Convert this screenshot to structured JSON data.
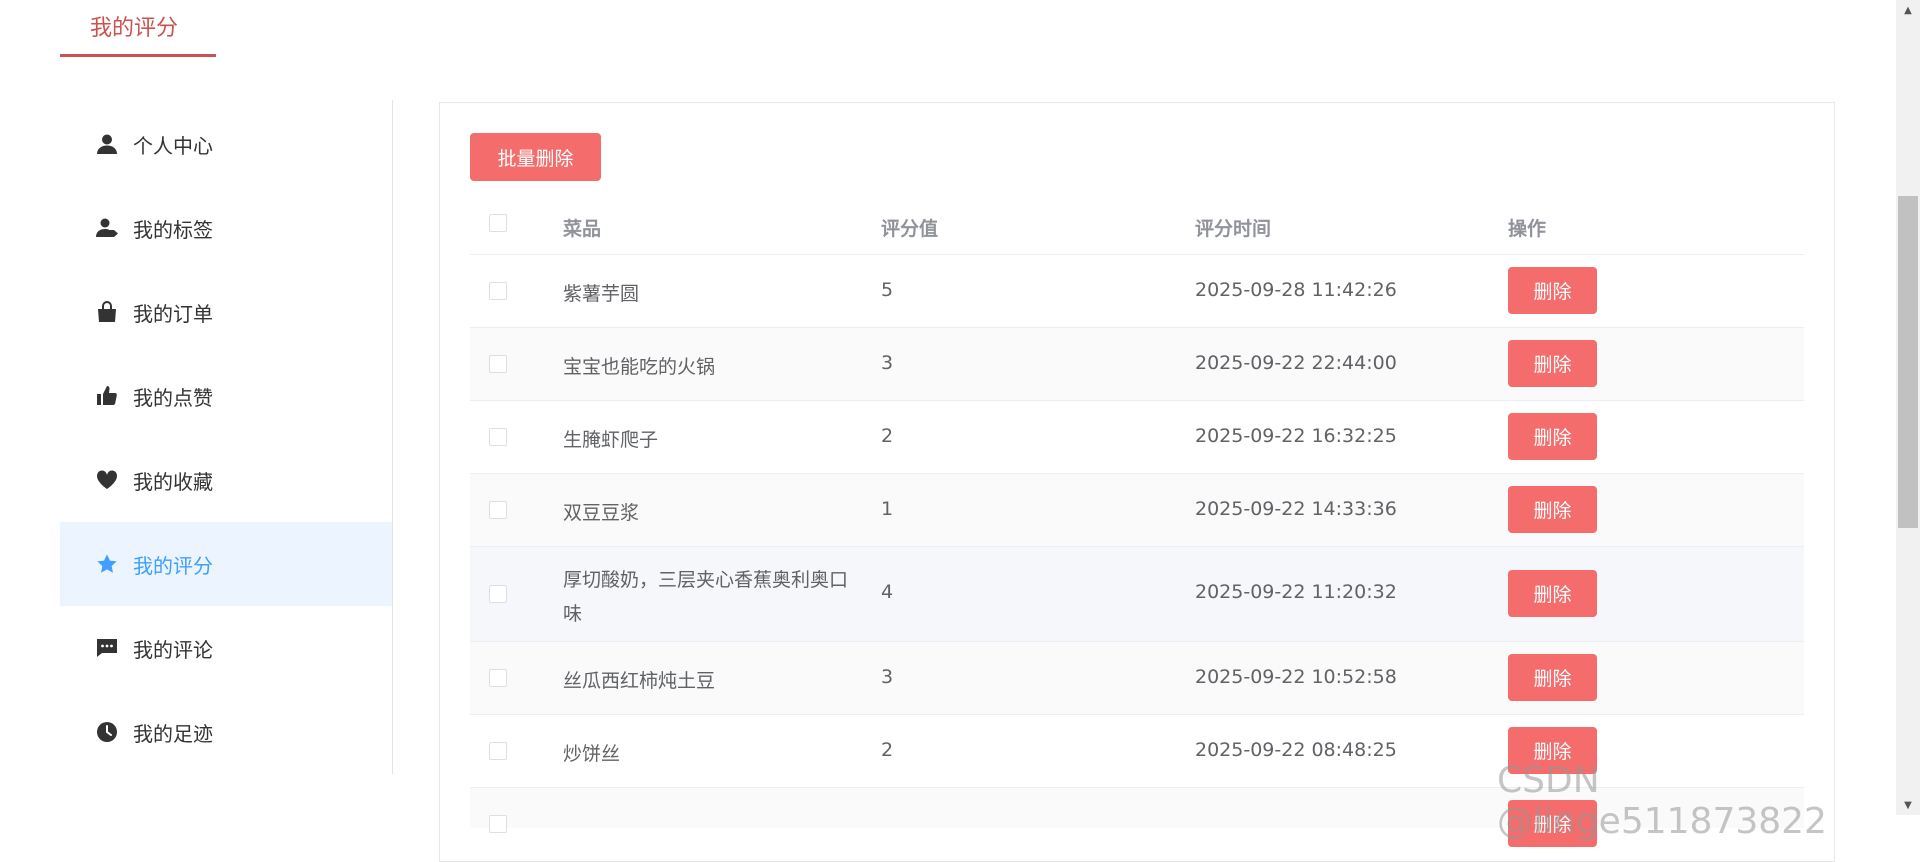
{
  "tab": {
    "title": "我的评分"
  },
  "sidebar": {
    "items": [
      {
        "label": "个人中心",
        "icon": "user-icon",
        "active": false
      },
      {
        "label": "我的标签",
        "icon": "user-tag-icon",
        "active": false
      },
      {
        "label": "我的订单",
        "icon": "shopping-bag-icon",
        "active": false
      },
      {
        "label": "我的点赞",
        "icon": "thumbs-up-icon",
        "active": false
      },
      {
        "label": "我的收藏",
        "icon": "heart-icon",
        "active": false
      },
      {
        "label": "我的评分",
        "icon": "star-icon",
        "active": true
      },
      {
        "label": "我的评论",
        "icon": "comment-icon",
        "active": false
      },
      {
        "label": "我的足迹",
        "icon": "clock-icon",
        "active": false
      }
    ]
  },
  "toolbar": {
    "batch_delete_label": "批量删除"
  },
  "table": {
    "columns": [
      "菜品",
      "评分值",
      "评分时间",
      "操作"
    ],
    "delete_label": "删除",
    "rows": [
      {
        "dish": "紫薯芋圆",
        "score": "5",
        "time": "2025-09-28 11:42:26"
      },
      {
        "dish": "宝宝也能吃的火锅",
        "score": "3",
        "time": "2025-09-22 22:44:00"
      },
      {
        "dish": "生腌虾爬子",
        "score": "2",
        "time": "2025-09-22 16:32:25"
      },
      {
        "dish": "双豆豆浆",
        "score": "1",
        "time": "2025-09-22 14:33:36"
      },
      {
        "dish": "厚切酸奶，三层夹心香蕉奥利奥口味",
        "score": "4",
        "time": "2025-09-22 11:20:32"
      },
      {
        "dish": "丝瓜西红柿炖土豆",
        "score": "3",
        "time": "2025-09-22 10:52:58"
      },
      {
        "dish": "炒饼丝",
        "score": "2",
        "time": "2025-09-22 08:48:25"
      }
    ]
  },
  "colors": {
    "accent": "#409eff",
    "danger": "#f56c6c",
    "tab_accent": "#c9544f"
  },
  "watermark": "CSDN @linge511873822"
}
